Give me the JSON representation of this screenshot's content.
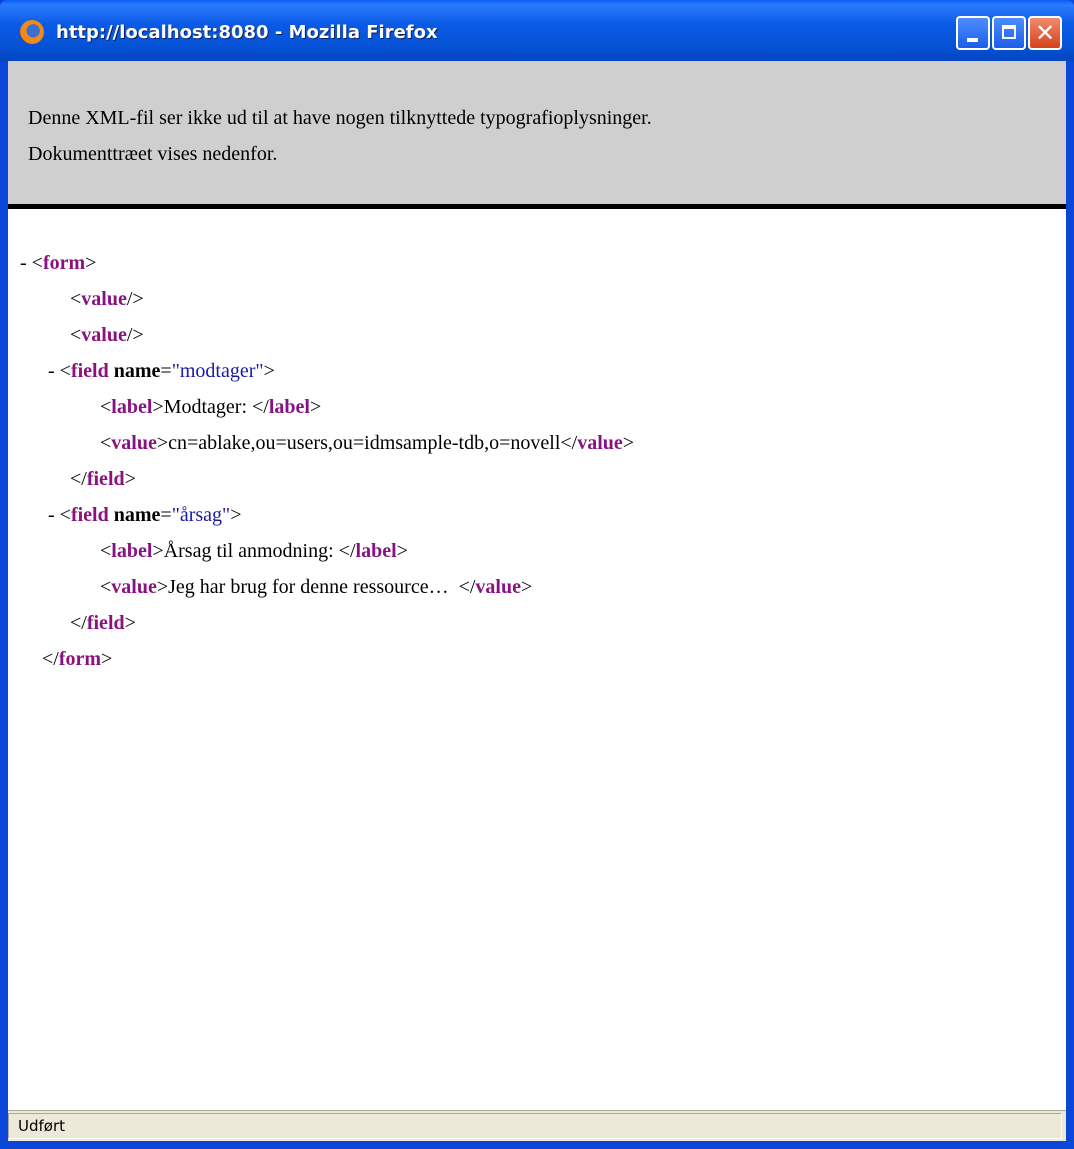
{
  "window": {
    "title": "http://localhost:8080 - Mozilla Firefox",
    "controls": {
      "minimize": "_",
      "maximize": "□",
      "close": "✕"
    },
    "icon": "firefox-icon"
  },
  "info": {
    "line1": "Denne XML-fil ser ikke ud til at have nogen tilknyttede typografioplysninger.",
    "line2": "Dokumenttræet vises nedenfor."
  },
  "xml": {
    "form_open": {
      "prefix": "- <",
      "tag": "form",
      "suffix": ">"
    },
    "value1": {
      "prefix": "<",
      "tag": "value",
      "suffix": "/>"
    },
    "value2": {
      "prefix": "<",
      "tag": "value",
      "suffix": "/>"
    },
    "field1": {
      "prefix": "- <",
      "tag": "field",
      "attr": " name",
      "eq": "=",
      "val": "\"modtager\"",
      "suffix": ">",
      "label": {
        "open_pre": "<",
        "open_tag": "label",
        "open_suf": ">",
        "text": "Modtager: ",
        "close_pre": "</",
        "close_tag": "label",
        "close_suf": ">"
      },
      "value": {
        "open_pre": "<",
        "open_tag": "value",
        "open_suf": ">",
        "text": "cn=ablake,ou=users,ou=idmsample-tdb,o=novell",
        "close_pre": "</",
        "close_tag": "value",
        "close_suf": ">"
      },
      "close": {
        "pre": "</",
        "tag": "field",
        "suf": ">"
      }
    },
    "field2": {
      "prefix": "- <",
      "tag": "field",
      "attr": " name",
      "eq": "=",
      "val": "\"årsag\"",
      "suffix": ">",
      "label": {
        "open_pre": "<",
        "open_tag": "label",
        "open_suf": ">",
        "text": "Årsag til anmodning: ",
        "close_pre": "</",
        "close_tag": "label",
        "close_suf": ">"
      },
      "value": {
        "open_pre": "<",
        "open_tag": "value",
        "open_suf": ">",
        "text": "Jeg har brug for denne ressource…  ",
        "close_pre": "</",
        "close_tag": "value",
        "close_suf": ">"
      },
      "close": {
        "pre": "</",
        "tag": "field",
        "suf": ">"
      }
    },
    "form_close": {
      "prefix": "</",
      "tag": "form",
      "suffix": ">"
    }
  },
  "status": {
    "text": "Udført"
  }
}
